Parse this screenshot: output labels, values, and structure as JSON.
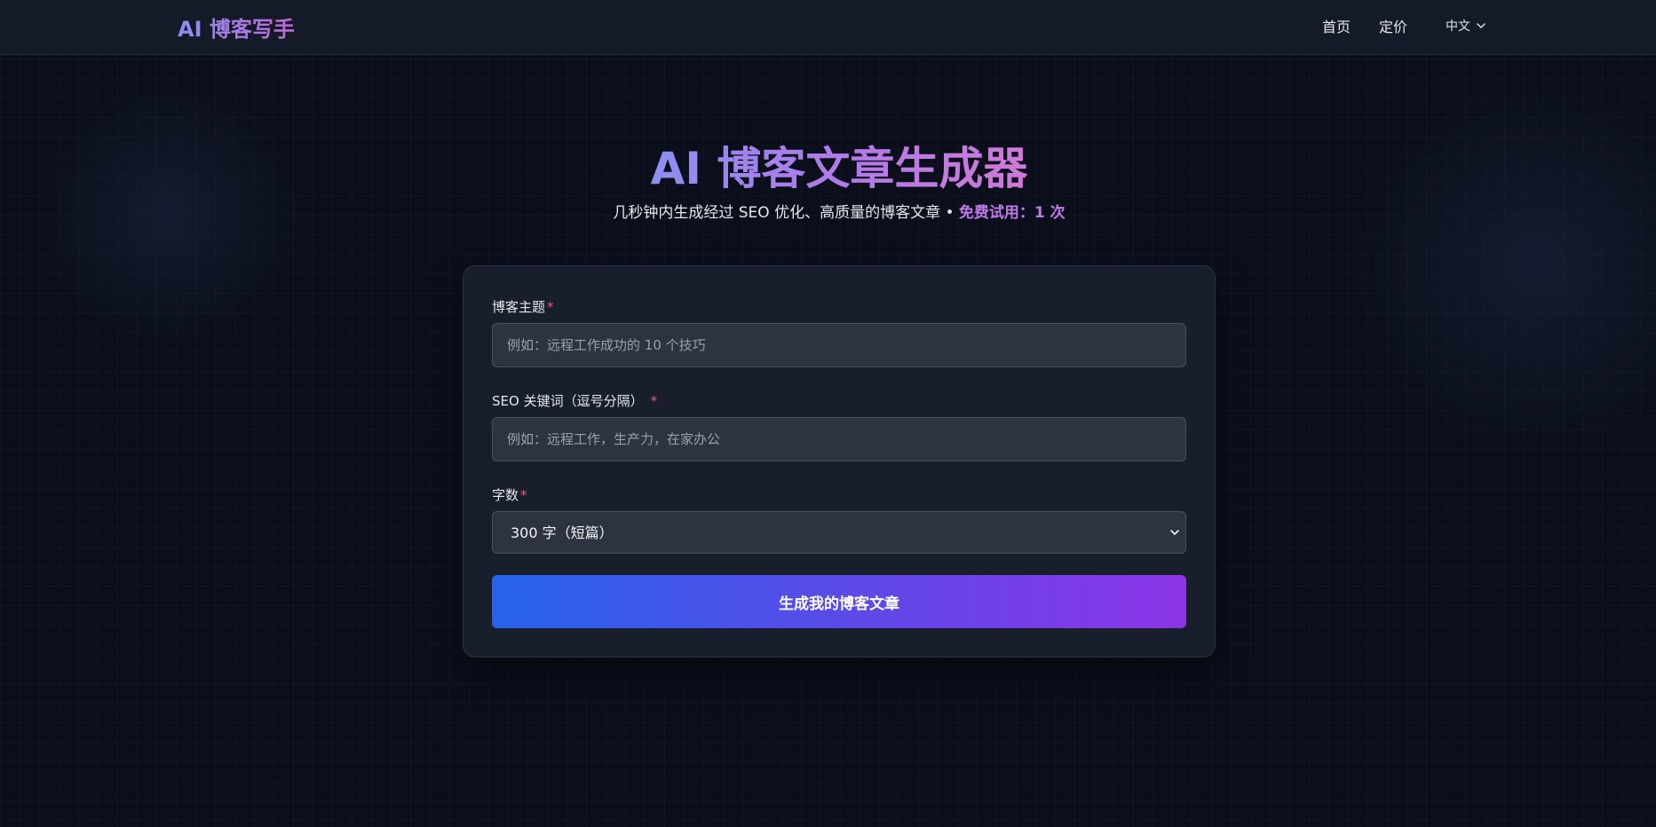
{
  "navbar": {
    "brand": "AI 博客写手",
    "links": [
      "首页",
      "定价"
    ],
    "language": "中文"
  },
  "hero": {
    "title": "AI 博客文章生成器",
    "subtitle": "几秒钟内生成经过 SEO 优化、高质量的博客文章 •",
    "trial": "免费试用：1 次"
  },
  "form": {
    "topic": {
      "label": "博客主题",
      "required_mark": "*",
      "placeholder": "例如：远程工作成功的 10 个技巧",
      "value": ""
    },
    "keywords": {
      "label": "SEO 关键词（逗号分隔）",
      "required_mark": "*",
      "placeholder": "例如：远程工作，生产力，在家办公",
      "value": ""
    },
    "word_count": {
      "label": "字数",
      "required_mark": "*",
      "selected": "300 字（短篇）"
    },
    "submit_label": "生成我的博客文章"
  },
  "colors": {
    "background": "#0b0f1c",
    "card": "#191e2c",
    "accent_start": "#2563eb",
    "accent_end": "#8b34e6",
    "required": "#ef5a6f"
  }
}
